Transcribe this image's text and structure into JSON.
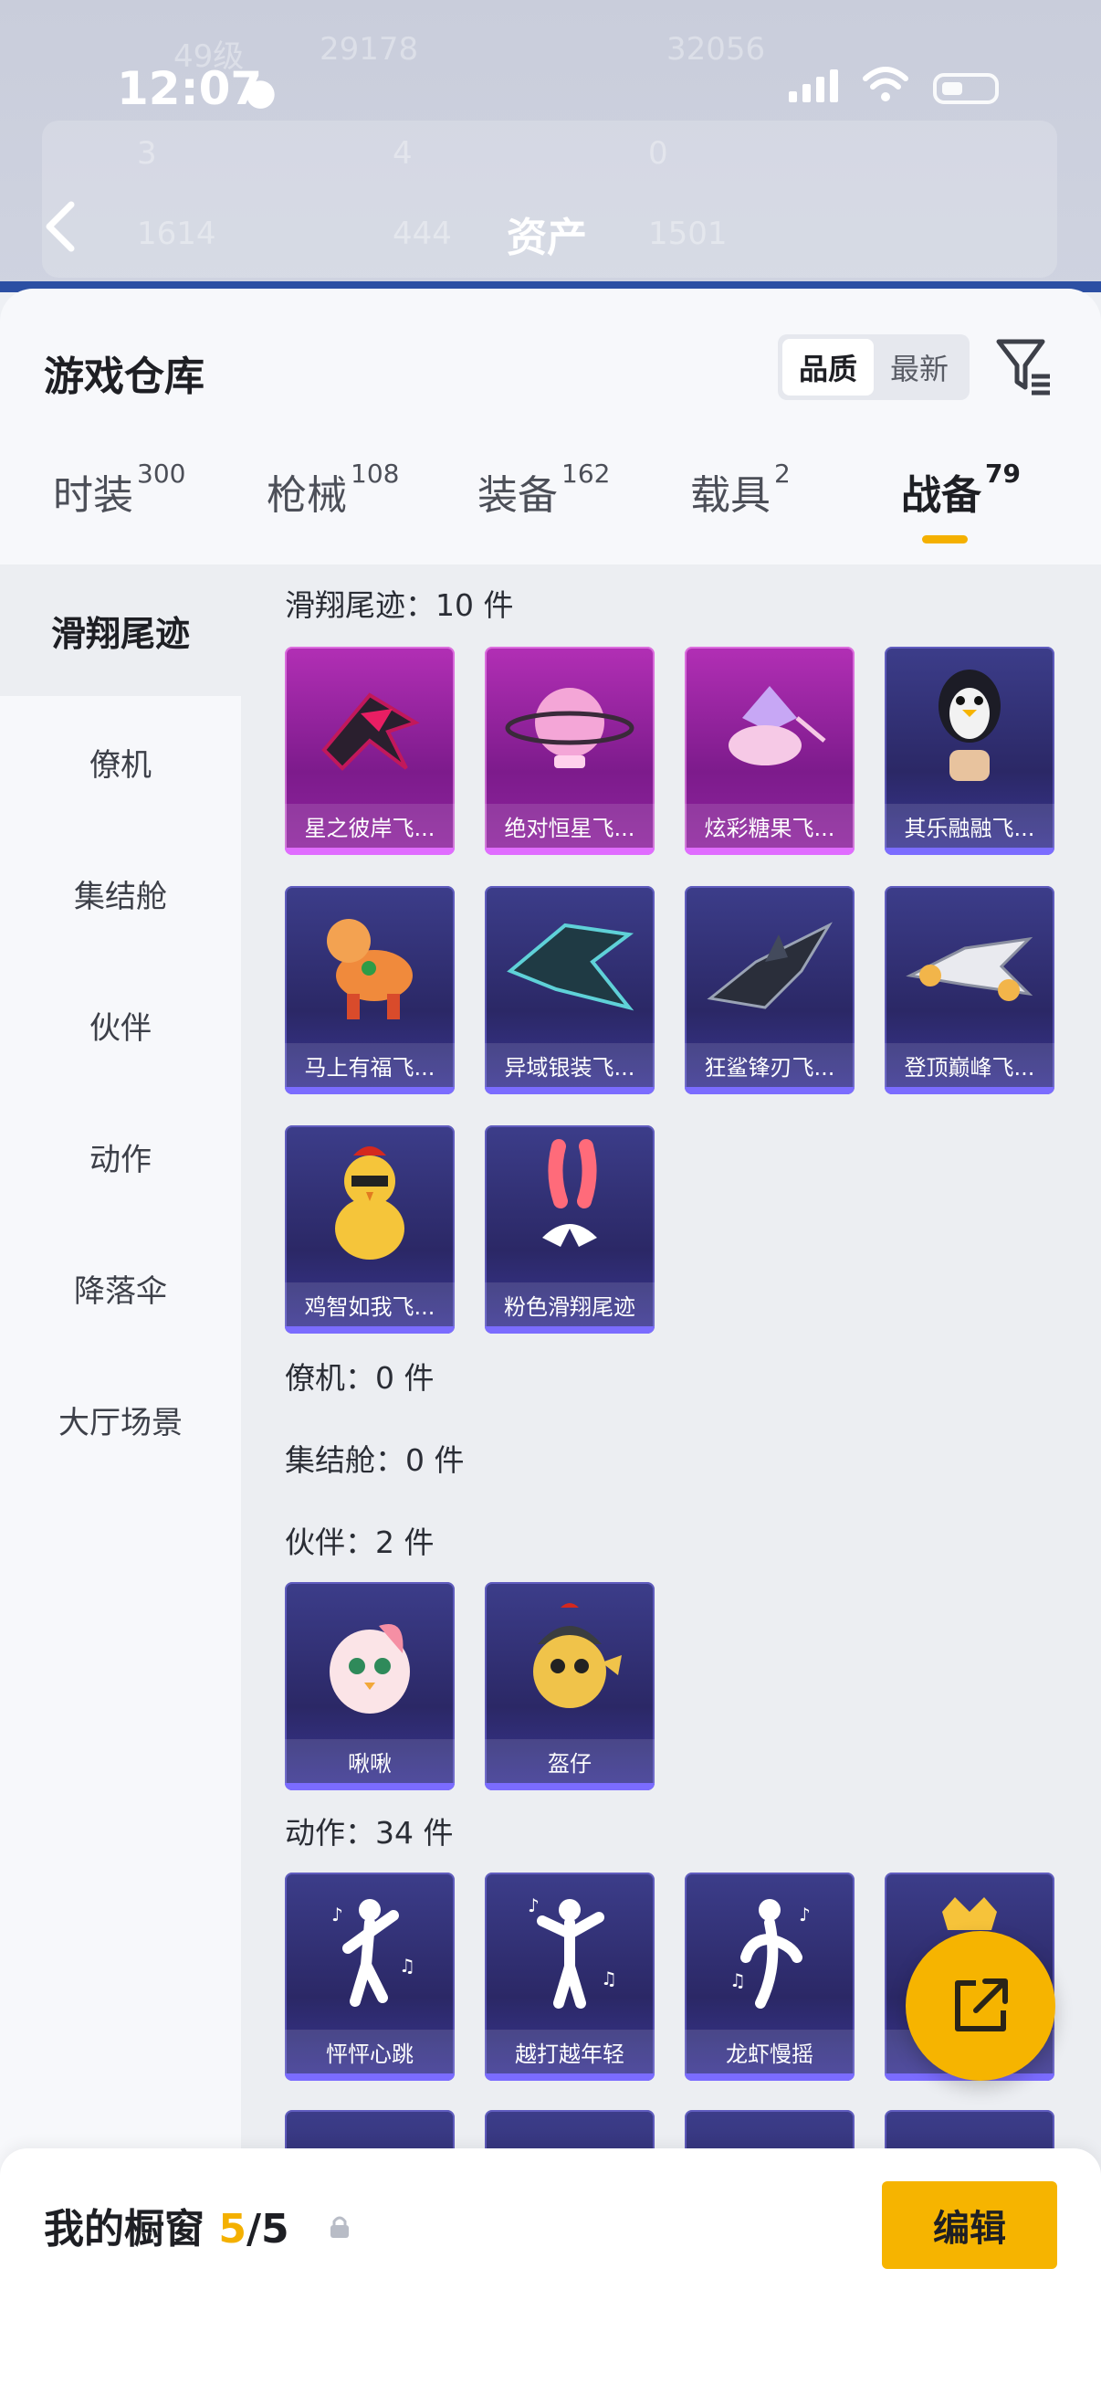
{
  "status_bar": {
    "time": "12:07"
  },
  "background": {
    "title": "资产",
    "stats": [
      "49级",
      "29178",
      "32056",
      "3",
      "4",
      "0",
      "1614",
      "444",
      "1501"
    ]
  },
  "warehouse": {
    "title": "游戏仓库",
    "sort": {
      "quality_label": "品质",
      "newest_label": "最新",
      "active": "品质"
    }
  },
  "tabs": [
    {
      "label": "时装",
      "count": "300"
    },
    {
      "label": "枪械",
      "count": "108"
    },
    {
      "label": "装备",
      "count": "162"
    },
    {
      "label": "载具",
      "count": "2"
    },
    {
      "label": "战备",
      "count": "79"
    }
  ],
  "active_tab": "战备",
  "sidebar": {
    "items": [
      {
        "label": "滑翔尾迹"
      },
      {
        "label": "僚机"
      },
      {
        "label": "集结舱"
      },
      {
        "label": "伙伴"
      },
      {
        "label": "动作"
      },
      {
        "label": "降落伞"
      },
      {
        "label": "大厅场景"
      }
    ],
    "active": "滑翔尾迹"
  },
  "sections": {
    "glide": {
      "title": "滑翔尾迹：10 件",
      "items": [
        {
          "name": "星之彼岸飞...",
          "rarity": "epic",
          "icon": "dark-wing-ship-icon"
        },
        {
          "name": "绝对恒星飞...",
          "rarity": "epic",
          "icon": "pink-planet-icon"
        },
        {
          "name": "炫彩糖果飞...",
          "rarity": "epic",
          "icon": "candy-icon"
        },
        {
          "name": "其乐融融飞...",
          "rarity": "rare",
          "icon": "penguin-balloon-icon"
        },
        {
          "name": "马上有福飞...",
          "rarity": "rare",
          "icon": "horse-toy-icon"
        },
        {
          "name": "异域银装飞...",
          "rarity": "rare",
          "icon": "teal-ship-icon"
        },
        {
          "name": "狂鲨锋刃飞...",
          "rarity": "rare",
          "icon": "shark-ship-icon"
        },
        {
          "name": "登顶巅峰飞...",
          "rarity": "rare",
          "icon": "jet-ship-icon"
        },
        {
          "name": "鸡智如我飞...",
          "rarity": "rare",
          "icon": "chicken-icon"
        },
        {
          "name": "粉色滑翔尾迹",
          "rarity": "rare",
          "icon": "pink-smoke-trail-icon"
        }
      ]
    },
    "wingman": {
      "title": "僚机：0 件"
    },
    "pod": {
      "title": "集结舱：0 件"
    },
    "companion": {
      "title": "伙伴：2 件",
      "items": [
        {
          "name": "啾啾",
          "rarity": "rare",
          "icon": "pink-bird-icon"
        },
        {
          "name": "盔仔",
          "rarity": "rare",
          "icon": "helmet-chick-icon"
        }
      ]
    },
    "emote": {
      "title": "动作：34 件",
      "items": [
        {
          "name": "怦怦心跳",
          "rarity": "rare",
          "icon": "dance-pose-icon"
        },
        {
          "name": "越打越年轻",
          "rarity": "rare",
          "icon": "dance-pose-icon"
        },
        {
          "name": "龙虾慢摇",
          "rarity": "rare",
          "icon": "dance-pose-icon"
        },
        {
          "name": "",
          "rarity": "rare",
          "icon": "golden-crown-icon"
        }
      ]
    }
  },
  "showcase": {
    "label": "我的橱窗",
    "count": "5",
    "sep": "/",
    "total": "5",
    "edit_label": "编辑"
  },
  "colors": {
    "accent": "#f6b400",
    "epic": "#9b25a8",
    "rare": "#32307a"
  }
}
